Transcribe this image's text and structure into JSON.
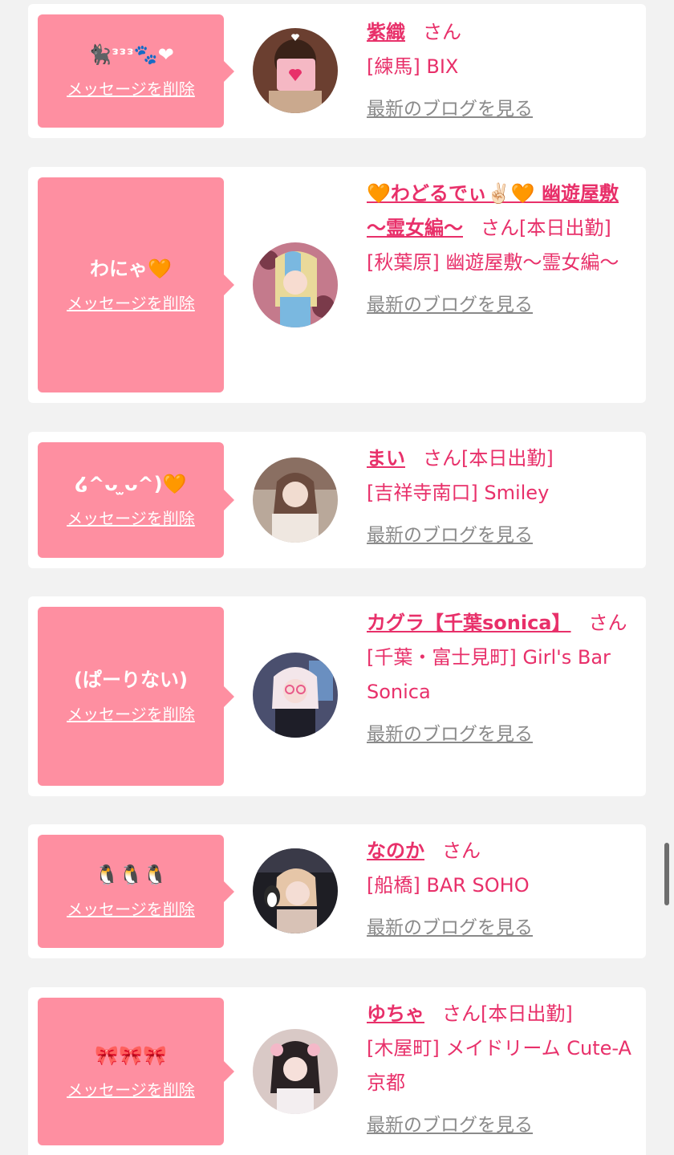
{
  "delete_label": "メッセージを削除",
  "blog_label": "最新のブログを見る",
  "san_label": "さん",
  "colors": {
    "accent_pink": "#fe8fa1",
    "name_pink": "#e8306a",
    "link_gray": "#8a8a8a",
    "background": "#f2f2f2"
  },
  "cards": [
    {
      "message": "🐈‍⬛ᵌᵌᵌ🐾❤",
      "name": "紫織",
      "badge": "",
      "shop": "[練馬] BIX"
    },
    {
      "message": "わにゃ🧡",
      "name": "🧡わどるでぃ✌🏻🧡 幽遊屋敷 〜霊女編〜",
      "badge": "[本日出勤]",
      "shop": "[秋葉原] 幽遊屋敷〜霊女編〜"
    },
    {
      "message": "໒^ᴗ ̫ᴗ^)🧡",
      "name": "まい",
      "badge": "[本日出勤]",
      "shop": "[吉祥寺南口] Smiley"
    },
    {
      "message": "(ぱーりない)",
      "name": "カグラ【千葉sonica】",
      "badge": "",
      "shop": "[千葉・富士見町] Girl's Bar Sonica"
    },
    {
      "message": "🐧🐧🐧",
      "name": "なのか",
      "badge": "",
      "shop": "[船橋] BAR SOHO"
    },
    {
      "message": "🎀🎀🎀",
      "name": "ゆちゃ",
      "badge": "[本日出勤]",
      "shop": "[木屋町] メイドリーム Cute-A 京都"
    }
  ]
}
